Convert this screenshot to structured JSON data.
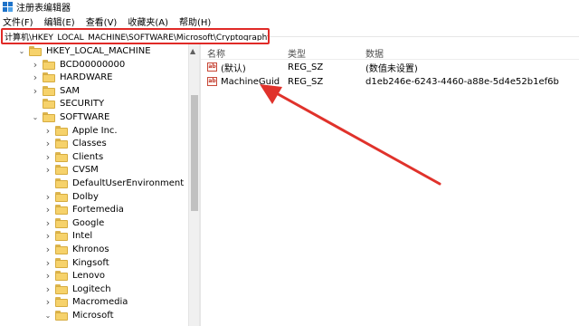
{
  "window": {
    "title": "注册表编辑器",
    "accent": "#1f73c9"
  },
  "menu": [
    {
      "label": "文件(F)"
    },
    {
      "label": "编辑(E)"
    },
    {
      "label": "查看(V)"
    },
    {
      "label": "收藏夹(A)"
    },
    {
      "label": "帮助(H)"
    }
  ],
  "address": {
    "value": "计算机\\HKEY_LOCAL_MACHINE\\SOFTWARE\\Microsoft\\Cryptography",
    "highlight_color": "#e02a27"
  },
  "tree": [
    {
      "label": "HKEY_LOCAL_MACHINE",
      "level": 0,
      "expanded": true
    },
    {
      "label": "BCD00000000",
      "level": 1,
      "expanded": false
    },
    {
      "label": "HARDWARE",
      "level": 1,
      "expanded": false
    },
    {
      "label": "SAM",
      "level": 1,
      "expanded": false
    },
    {
      "label": "SECURITY",
      "level": 1,
      "expanded": null
    },
    {
      "label": "SOFTWARE",
      "level": 1,
      "expanded": true
    },
    {
      "label": "Apple Inc.",
      "level": 2,
      "expanded": false
    },
    {
      "label": "Classes",
      "level": 2,
      "expanded": false
    },
    {
      "label": "Clients",
      "level": 2,
      "expanded": false
    },
    {
      "label": "CVSM",
      "level": 2,
      "expanded": false
    },
    {
      "label": "DefaultUserEnvironment",
      "level": 2,
      "expanded": null
    },
    {
      "label": "Dolby",
      "level": 2,
      "expanded": false
    },
    {
      "label": "Fortemedia",
      "level": 2,
      "expanded": false
    },
    {
      "label": "Google",
      "level": 2,
      "expanded": false
    },
    {
      "label": "Intel",
      "level": 2,
      "expanded": false
    },
    {
      "label": "Khronos",
      "level": 2,
      "expanded": false
    },
    {
      "label": "Kingsoft",
      "level": 2,
      "expanded": false
    },
    {
      "label": "Lenovo",
      "level": 2,
      "expanded": false
    },
    {
      "label": "Logitech",
      "level": 2,
      "expanded": false
    },
    {
      "label": "Macromedia",
      "level": 2,
      "expanded": false
    },
    {
      "label": "Microsoft",
      "level": 2,
      "expanded": true
    }
  ],
  "columns": {
    "name": "名称",
    "type": "类型",
    "data": "数据"
  },
  "values": [
    {
      "name": "(默认)",
      "type": "REG_SZ",
      "data": "(数值未设置)",
      "icon": "string-value-icon"
    },
    {
      "name": "MachineGuid",
      "type": "REG_SZ",
      "data": "d1eb246e-6243-4460-a88e-5d4e52b1ef6b",
      "icon": "string-value-icon"
    }
  ],
  "annotation_color": "#e0322b"
}
